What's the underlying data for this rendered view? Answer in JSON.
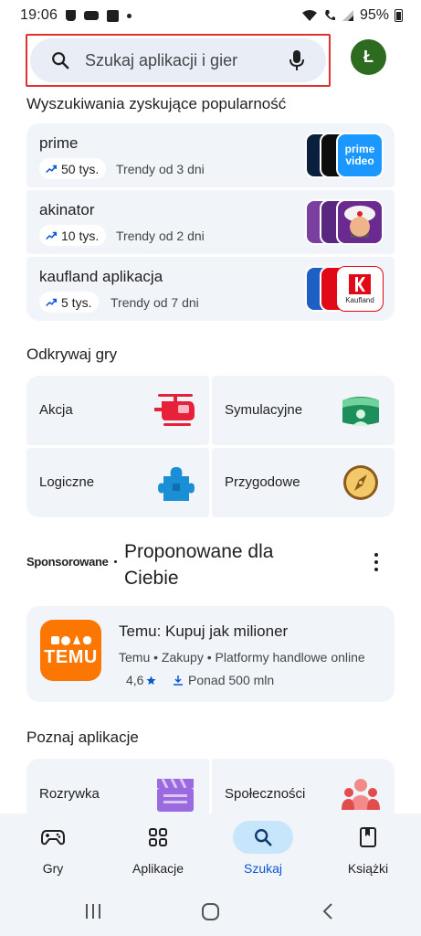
{
  "status_bar": {
    "time": "19:06",
    "battery": "95%"
  },
  "search": {
    "placeholder": "Szukaj aplikacji i gier"
  },
  "account": {
    "initial": "Ł"
  },
  "trending": {
    "title": "Wyszukiwania zyskujące popularność",
    "items": [
      {
        "name": "prime",
        "count": "50 tys.",
        "since": "Trendy od 3 dni",
        "icons": [
          "disney-icon",
          "max-icon",
          "prime-video-icon"
        ],
        "logo_text": "prime video"
      },
      {
        "name": "akinator",
        "count": "10 tys.",
        "since": "Trendy od 2 dni",
        "icons": [
          "akinator-icon-1",
          "akinator-icon-2",
          "akinator-icon-3"
        ]
      },
      {
        "name": "kaufland aplikacja",
        "count": "5 tys.",
        "since": "Trendy od 7 dni",
        "icons": [
          "blue-app-icon",
          "red-app-icon",
          "kaufland-icon"
        ],
        "logo_text": "Kaufland"
      }
    ]
  },
  "games": {
    "title": "Odkrywaj gry",
    "categories": [
      {
        "label": "Akcja",
        "icon": "helicopter-icon"
      },
      {
        "label": "Symulacyjne",
        "icon": "vr-headset-icon"
      },
      {
        "label": "Logiczne",
        "icon": "puzzle-icon"
      },
      {
        "label": "Przygodowe",
        "icon": "compass-icon"
      }
    ]
  },
  "sponsored": {
    "label": "Sponsorowane",
    "title": "Proponowane dla Ciebie",
    "app": {
      "name": "Temu: Kupuj jak milioner",
      "meta": "Temu • Zakupy • Platformy handlowe online",
      "rating": "4,6",
      "downloads": "Ponad 500 mln",
      "icon_text": "TEMU"
    }
  },
  "apps": {
    "title": "Poznaj aplikacje",
    "categories": [
      {
        "label": "Rozrywka",
        "icon": "clapperboard-icon"
      },
      {
        "label": "Społeczności",
        "icon": "people-icon"
      }
    ]
  },
  "bottom_nav": {
    "items": [
      {
        "label": "Gry",
        "icon": "gamepad-icon"
      },
      {
        "label": "Aplikacje",
        "icon": "apps-grid-icon"
      },
      {
        "label": "Szukaj",
        "icon": "search-icon",
        "active": true
      },
      {
        "label": "Książki",
        "icon": "book-icon"
      }
    ]
  },
  "colors": {
    "accent": "#0b57d0",
    "active_pill": "#c8e6fb",
    "card_bg": "#f1f4f9",
    "avatar": "#2d6b21",
    "highlight_border": "#e03131",
    "temu": "#fb7701"
  }
}
